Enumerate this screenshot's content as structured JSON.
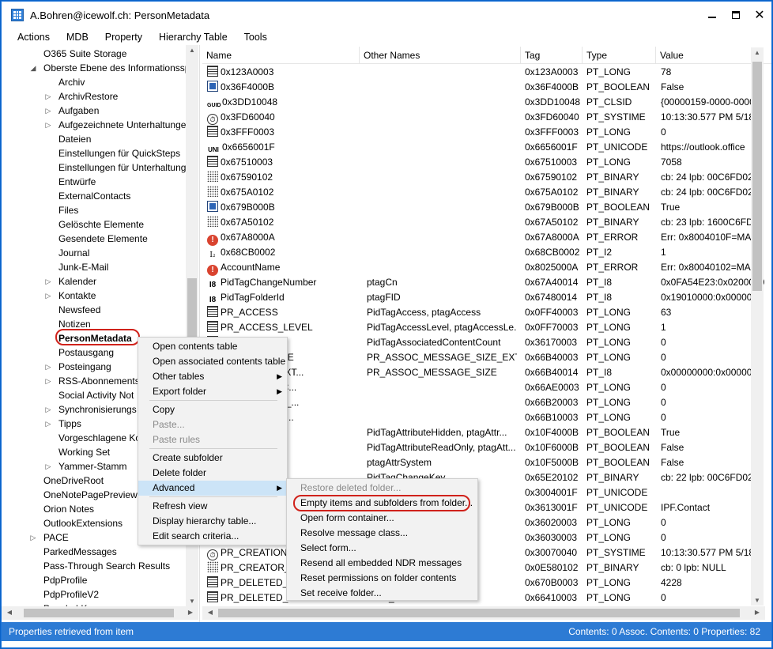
{
  "window": {
    "title": "A.Bohren@icewolf.ch: PersonMetadata",
    "controls": [
      "minimize",
      "maximize",
      "close"
    ]
  },
  "menubar": [
    "Actions",
    "MDB",
    "Property",
    "Hierarchy Table",
    "Tools"
  ],
  "tree": {
    "items": [
      {
        "label": "O365 Suite Storage",
        "level": 1,
        "arrow": ""
      },
      {
        "label": "Oberste Ebene des Informationssp",
        "level": 1,
        "arrow": "expanded"
      },
      {
        "label": "Archiv",
        "level": 2,
        "arrow": ""
      },
      {
        "label": "ArchivRestore",
        "level": 2,
        "arrow": "collapsed"
      },
      {
        "label": "Aufgaben",
        "level": 2,
        "arrow": "collapsed"
      },
      {
        "label": "Aufgezeichnete Unterhaltunge",
        "level": 2,
        "arrow": "collapsed"
      },
      {
        "label": "Dateien",
        "level": 2,
        "arrow": ""
      },
      {
        "label": "Einstellungen für QuickSteps",
        "level": 2,
        "arrow": ""
      },
      {
        "label": "Einstellungen für Unterhaltung",
        "level": 2,
        "arrow": ""
      },
      {
        "label": "Entwürfe",
        "level": 2,
        "arrow": ""
      },
      {
        "label": "ExternalContacts",
        "level": 2,
        "arrow": ""
      },
      {
        "label": "Files",
        "level": 2,
        "arrow": ""
      },
      {
        "label": "Gelöschte Elemente",
        "level": 2,
        "arrow": ""
      },
      {
        "label": "Gesendete Elemente",
        "level": 2,
        "arrow": ""
      },
      {
        "label": "Journal",
        "level": 2,
        "arrow": ""
      },
      {
        "label": "Junk-E-Mail",
        "level": 2,
        "arrow": ""
      },
      {
        "label": "Kalender",
        "level": 2,
        "arrow": "collapsed"
      },
      {
        "label": "Kontakte",
        "level": 2,
        "arrow": "collapsed"
      },
      {
        "label": "Newsfeed",
        "level": 2,
        "arrow": ""
      },
      {
        "label": "Notizen",
        "level": 2,
        "arrow": ""
      },
      {
        "label": "PersonMetadata",
        "level": 2,
        "arrow": "",
        "selected": true
      },
      {
        "label": "Postausgang",
        "level": 2,
        "arrow": ""
      },
      {
        "label": "Posteingang",
        "level": 2,
        "arrow": "collapsed"
      },
      {
        "label": "RSS-Abonnements",
        "level": 2,
        "arrow": "collapsed"
      },
      {
        "label": "Social Activity Not",
        "level": 2,
        "arrow": ""
      },
      {
        "label": "Synchronisierungs",
        "level": 2,
        "arrow": "collapsed"
      },
      {
        "label": "Tipps",
        "level": 2,
        "arrow": "collapsed"
      },
      {
        "label": "Vorgeschlagene Ko",
        "level": 2,
        "arrow": ""
      },
      {
        "label": "Working Set",
        "level": 2,
        "arrow": ""
      },
      {
        "label": "Yammer-Stamm",
        "level": 2,
        "arrow": "collapsed"
      },
      {
        "label": "OneDriveRoot",
        "level": 1,
        "arrow": ""
      },
      {
        "label": "OneNotePagePreviews",
        "level": 1,
        "arrow": ""
      },
      {
        "label": "Orion Notes",
        "level": 1,
        "arrow": ""
      },
      {
        "label": "OutlookExtensions",
        "level": 1,
        "arrow": ""
      },
      {
        "label": "PACE",
        "level": 1,
        "arrow": "collapsed"
      },
      {
        "label": "ParkedMessages",
        "level": 1,
        "arrow": ""
      },
      {
        "label": "Pass-Through Search Results",
        "level": 1,
        "arrow": ""
      },
      {
        "label": "PdpProfile",
        "level": 1,
        "arrow": ""
      },
      {
        "label": "PdpProfileV2",
        "level": 1,
        "arrow": ""
      },
      {
        "label": "People I Know",
        "level": 1,
        "arrow": ""
      }
    ]
  },
  "columns": [
    "Name",
    "Other Names",
    "Tag",
    "Type",
    "Value"
  ],
  "rows": [
    {
      "icon": "long",
      "name": "0x123A0003",
      "other": "",
      "tag": "0x123A0003",
      "type": "PT_LONG",
      "value": "78"
    },
    {
      "icon": "bool",
      "name": "0x36F4000B",
      "other": "",
      "tag": "0x36F4000B",
      "type": "PT_BOOLEAN",
      "value": "False"
    },
    {
      "icon": "guid",
      "name": "0x3DD10048",
      "other": "",
      "tag": "0x3DD10048",
      "type": "PT_CLSID",
      "value": "{00000159-0000-0000-"
    },
    {
      "icon": "time",
      "name": "0x3FD60040",
      "other": "",
      "tag": "0x3FD60040",
      "type": "PT_SYSTIME",
      "value": "10:13:30.577 PM 5/18/"
    },
    {
      "icon": "long",
      "name": "0x3FFF0003",
      "other": "",
      "tag": "0x3FFF0003",
      "type": "PT_LONG",
      "value": "0"
    },
    {
      "icon": "uni",
      "name": "0x6656001F",
      "other": "",
      "tag": "0x6656001F",
      "type": "PT_UNICODE",
      "value": "https://outlook.office"
    },
    {
      "icon": "long",
      "name": "0x67510003",
      "other": "",
      "tag": "0x67510003",
      "type": "PT_LONG",
      "value": "7058"
    },
    {
      "icon": "bin",
      "name": "0x67590102",
      "other": "",
      "tag": "0x67590102",
      "type": "PT_BINARY",
      "value": "cb: 24 lpb: 00C6FD021"
    },
    {
      "icon": "bin",
      "name": "0x675A0102",
      "other": "",
      "tag": "0x675A0102",
      "type": "PT_BINARY",
      "value": "cb: 24 lpb: 00C6FD021"
    },
    {
      "icon": "bool",
      "name": "0x679B000B",
      "other": "",
      "tag": "0x679B000B",
      "type": "PT_BOOLEAN",
      "value": "True"
    },
    {
      "icon": "bin",
      "name": "0x67A50102",
      "other": "",
      "tag": "0x67A50102",
      "type": "PT_BINARY",
      "value": "cb: 23 lpb: 1600C6FD0"
    },
    {
      "icon": "err",
      "name": "0x67A8000A",
      "other": "",
      "tag": "0x67A8000A",
      "type": "PT_ERROR",
      "value": "Err: 0x8004010F=MAP"
    },
    {
      "icon": "i2",
      "name": "0x68CB0002",
      "other": "",
      "tag": "0x68CB0002",
      "type": "PT_I2",
      "value": "1"
    },
    {
      "icon": "err",
      "name": "AccountName",
      "other": "",
      "tag": "0x8025000A",
      "type": "PT_ERROR",
      "value": "Err: 0x80040102=MAP"
    },
    {
      "icon": "i8",
      "name": "PidTagChangeNumber",
      "other": "ptagCn",
      "tag": "0x67A40014",
      "type": "PT_I8",
      "value": "0x0FA54E23:0x0200000"
    },
    {
      "icon": "i8",
      "name": "PidTagFolderId",
      "other": "ptagFID",
      "tag": "0x67480014",
      "type": "PT_I8",
      "value": "0x19010000:0x0000000"
    },
    {
      "icon": "long",
      "name": "PR_ACCESS",
      "other": "PidTagAccess, ptagAccess",
      "tag": "0x0FF40003",
      "type": "PT_LONG",
      "value": "63"
    },
    {
      "icon": "long",
      "name": "PR_ACCESS_LEVEL",
      "other": "PidTagAccessLevel, ptagAccessLe...",
      "tag": "0x0FF70003",
      "type": "PT_LONG",
      "value": "1"
    },
    {
      "icon": "long",
      "name": "ENT_COUNT",
      "other": "PidTagAssociatedContentCount",
      "tag": "0x36170003",
      "type": "PT_LONG",
      "value": "0"
    },
    {
      "icon": "long",
      "name": "MESSAGE_SIZE",
      "other": "PR_ASSOC_MESSAGE_SIZE_EXTEN...",
      "tag": "0x66B40003",
      "type": "PT_LONG",
      "value": "0"
    },
    {
      "icon": "i8",
      "name": "SAGE_SIZE_EXT...",
      "other": "PR_ASSOC_MESSAGE_SIZE",
      "tag": "0x66B40014",
      "type": "PT_I8",
      "value": "0x00000000:0x0000000"
    },
    {
      "icon": "long",
      "name": "_W_ATTACH_C...",
      "other": "",
      "tag": "0x66AE0003",
      "type": "PT_LONG",
      "value": "0"
    },
    {
      "icon": "long",
      "name": "_ASSOC_MSG_...",
      "other": "",
      "tag": "0x66B20003",
      "type": "PT_LONG",
      "value": "0"
    },
    {
      "icon": "long",
      "name": "_NORMAL_MS...",
      "other": "",
      "tag": "0x66B10003",
      "type": "PT_LONG",
      "value": "0"
    },
    {
      "icon": "bool",
      "name": "N",
      "other": "PidTagAttributeHidden, ptagAttr...",
      "tag": "0x10F4000B",
      "type": "PT_BOOLEAN",
      "value": "True"
    },
    {
      "icon": "bool",
      "name": "ONLY",
      "other": "PidTagAttributeReadOnly, ptagAtt...",
      "tag": "0x10F6000B",
      "type": "PT_BOOLEAN",
      "value": "False"
    },
    {
      "icon": "bool",
      "name": "M",
      "other": "ptagAttrSystem",
      "tag": "0x10F5000B",
      "type": "PT_BOOLEAN",
      "value": "False"
    },
    {
      "icon": "bin",
      "name": "Y",
      "other": "PidTagChangeKey",
      "tag": "0x65E20102",
      "type": "PT_BINARY",
      "value": "cb: 22 lpb: 00C6FD021"
    },
    {
      "icon": "uni",
      "name": "",
      "other": "omme...",
      "tag": "0x3004001F",
      "type": "PT_UNICODE",
      "value": ""
    },
    {
      "icon": "uni",
      "name": "",
      "other": "PidTag...",
      "tag": "0x3613001F",
      "type": "PT_UNICODE",
      "value": "IPF.Contact"
    },
    {
      "icon": "long",
      "name": "",
      "other": "Conte...",
      "tag": "0x36020003",
      "type": "PT_LONG",
      "value": "0"
    },
    {
      "icon": "long",
      "name": "",
      "other": "t, ptag...",
      "tag": "0x36030003",
      "type": "PT_LONG",
      "value": "0"
    },
    {
      "icon": "time",
      "name": "PR_CREATION_",
      "other": "reatio...",
      "tag": "0x30070040",
      "type": "PT_SYSTIME",
      "value": "10:13:30.577 PM 5/18/"
    },
    {
      "icon": "bin",
      "name": "PR_CREATOR_S",
      "other": "",
      "tag": "0x0E580102",
      "type": "PT_BINARY",
      "value": "cb: 0 lpb: NULL"
    },
    {
      "icon": "long",
      "name": "PR_DELETED_C",
      "other": "ptagDe...",
      "tag": "0x670B0003",
      "type": "PT_LONG",
      "value": "4228"
    },
    {
      "icon": "long",
      "name": "PR_DELETED_FC",
      "other": "MAIL_...",
      "tag": "0x66410003",
      "type": "PT_LONG",
      "value": "0"
    }
  ],
  "context_menu": {
    "items": [
      {
        "label": "Open contents table",
        "enabled": true
      },
      {
        "label": "Open associated contents table",
        "enabled": true
      },
      {
        "label": "Other tables",
        "enabled": true,
        "submenu": true
      },
      {
        "label": "Export folder",
        "enabled": true,
        "submenu": true
      },
      {
        "label": "Copy",
        "enabled": true,
        "sep_before": true
      },
      {
        "label": "Paste...",
        "enabled": false
      },
      {
        "label": "Paste rules",
        "enabled": false
      },
      {
        "label": "Create subfolder",
        "enabled": true,
        "sep_before": true
      },
      {
        "label": "Delete folder",
        "enabled": true
      },
      {
        "label": "Advanced",
        "enabled": true,
        "submenu": true,
        "highlighted": true
      },
      {
        "label": "Refresh view",
        "enabled": true,
        "sep_before": true
      },
      {
        "label": "Display hierarchy table...",
        "enabled": true
      },
      {
        "label": "Edit search criteria...",
        "enabled": true
      }
    ]
  },
  "advanced_submenu": {
    "items": [
      {
        "label": "Restore deleted folder...",
        "enabled": false
      },
      {
        "label": "Empty items and subfolders from folder...",
        "enabled": true,
        "circled": true
      },
      {
        "label": "Open form container...",
        "enabled": true
      },
      {
        "label": "Resolve message class...",
        "enabled": true
      },
      {
        "label": "Select form...",
        "enabled": true
      },
      {
        "label": "Resend all embedded NDR messages",
        "enabled": true
      },
      {
        "label": "Reset permissions on folder contents",
        "enabled": true
      },
      {
        "label": "Set receive folder...",
        "enabled": true
      }
    ]
  },
  "status": {
    "left": "Properties retrieved from item",
    "right": "Contents: 0  Assoc. Contents: 0  Properties: 82"
  },
  "colors": {
    "accent": "#2d7bd4",
    "highlight": "#cce4f7",
    "annotation": "#d0221b"
  }
}
